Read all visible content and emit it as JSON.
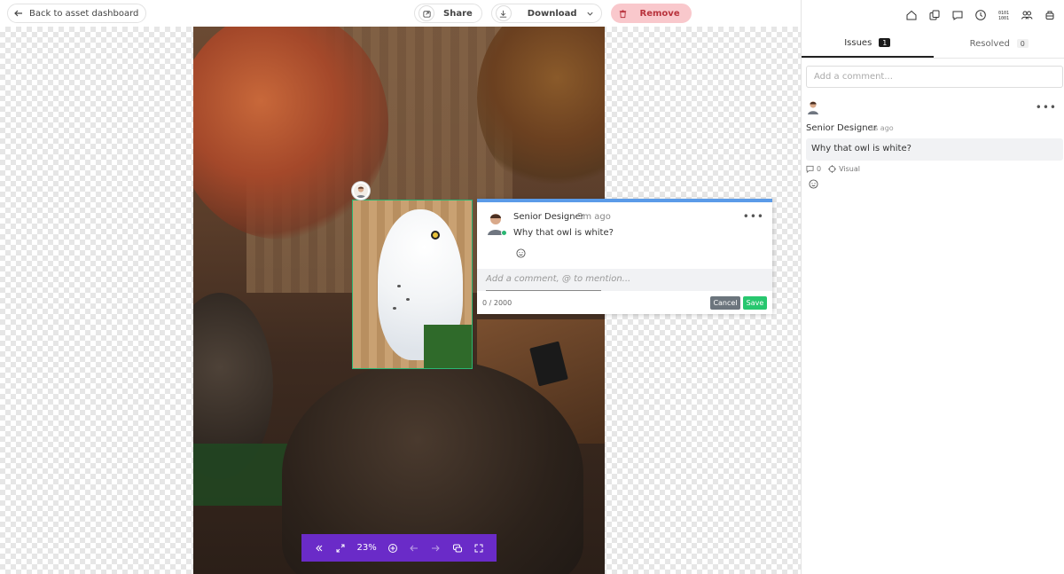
{
  "topbar": {
    "back_label": "Back to asset dashboard",
    "share_label": "Share",
    "download_label": "Download",
    "remove_label": "Remove"
  },
  "popup": {
    "author": "Senior Designer",
    "time": "3m ago",
    "body": "Why that owl is white?",
    "reply_placeholder": "Add a comment, @ to mention...",
    "char_count": "0 / 2000",
    "cancel_label": "Cancel",
    "save_label": "Save"
  },
  "zoombar": {
    "zoom": "23%"
  },
  "panel": {
    "tabs": [
      {
        "label": "Issues",
        "count": "1"
      },
      {
        "label": "Resolved",
        "count": "0"
      }
    ],
    "comment_placeholder": "Add a comment...",
    "entry": {
      "author": "Senior Designer",
      "time": "1s ago",
      "body": "Why that owl is white?",
      "replies": "0",
      "tag": "Visual"
    }
  },
  "colors": {
    "accent_purple": "#6a2bc8",
    "selection_green": "#2bb673",
    "popup_blue": "#5b9be8",
    "remove_pink": "#f9c8cc",
    "save_green": "#28c76f"
  }
}
